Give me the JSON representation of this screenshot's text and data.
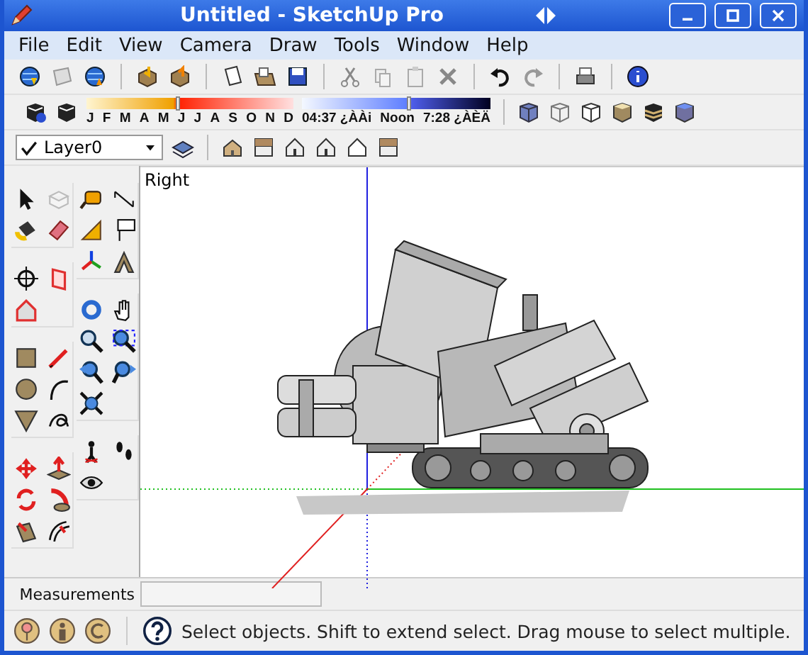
{
  "window": {
    "title": "Untitled - SketchUp Pro"
  },
  "menu": [
    {
      "label": "File"
    },
    {
      "label": "Edit"
    },
    {
      "label": "View"
    },
    {
      "label": "Camera"
    },
    {
      "label": "Draw"
    },
    {
      "label": "Tools"
    },
    {
      "label": "Window"
    },
    {
      "label": "Help"
    }
  ],
  "shadow_settings": {
    "date_slider": {
      "level": 0.43,
      "labels": [
        "J",
        "F",
        "M",
        "A",
        "M",
        "J",
        "J",
        "A",
        "S",
        "O",
        "N",
        "D"
      ]
    },
    "time_slider": {
      "level": 0.56,
      "labels": [
        "04:37 ¿ÀÀi",
        "Noon",
        "7:28 ¿ÀÈÄ"
      ]
    }
  },
  "layer": {
    "value": "Layer0"
  },
  "viewport": {
    "view_label": "Right"
  },
  "measurements": {
    "label": "Measurements"
  },
  "status_bar": {
    "text": "Select objects. Shift to extend select. Drag mouse to select multiple."
  }
}
